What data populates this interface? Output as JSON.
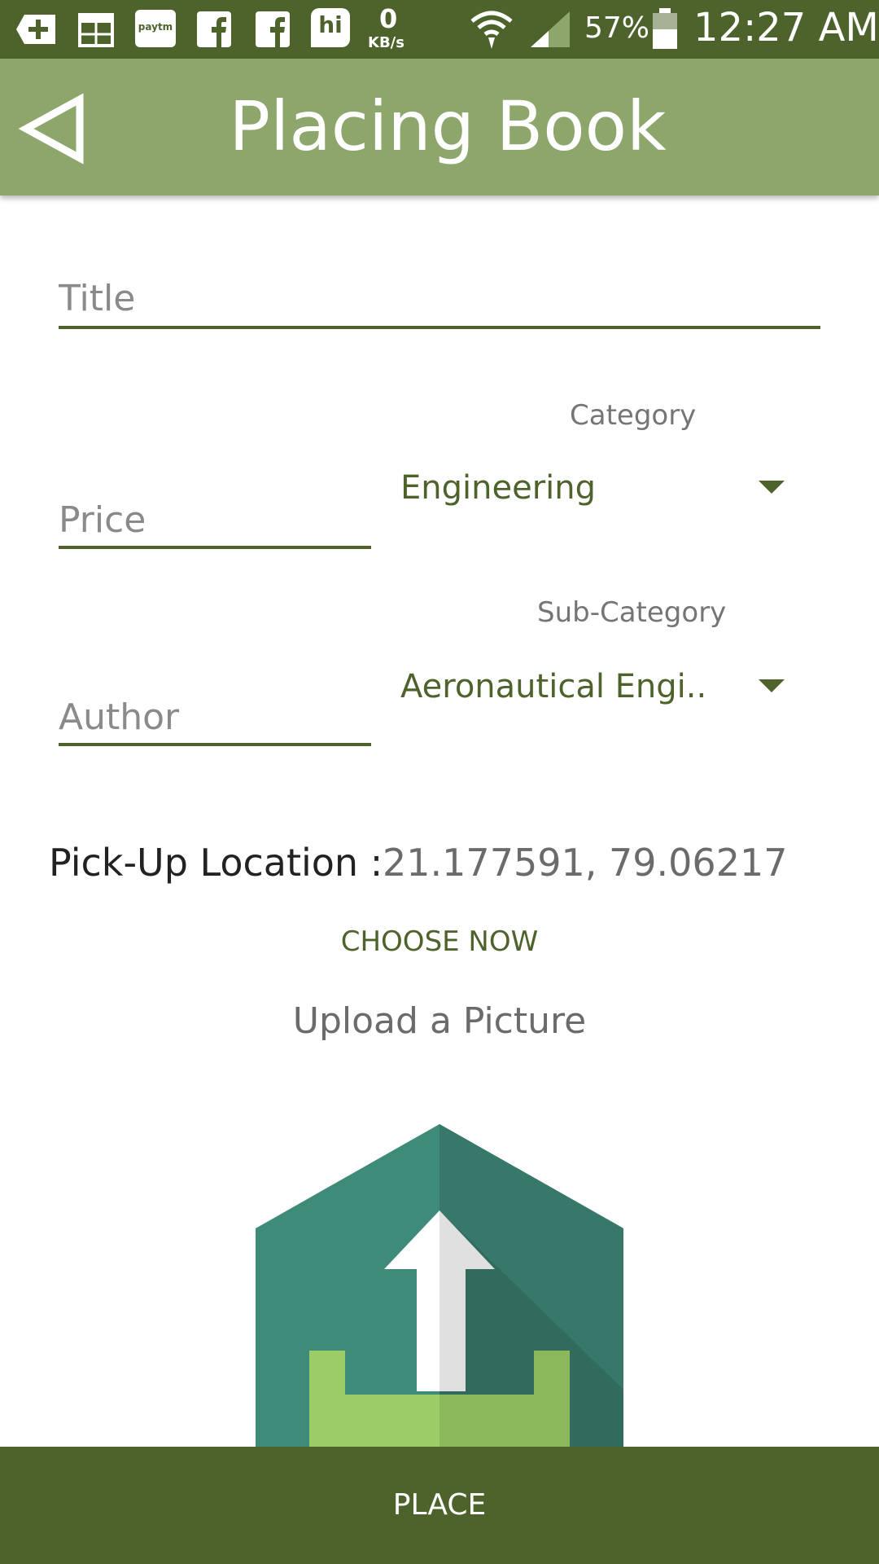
{
  "status_bar": {
    "icons": [
      "add-icon",
      "table-icon",
      "paytm-icon",
      "facebook-icon",
      "facebook-icon",
      "hike-icon",
      "wifi-icon",
      "signal-icon",
      "battery-icon"
    ],
    "paytm_text": "paytm",
    "hike_text": "hi",
    "data_speed_value": "0",
    "data_speed_unit": "KB/s",
    "battery": "57%",
    "time": "12:27 AM"
  },
  "app_bar": {
    "title": "Placing Book"
  },
  "form": {
    "title_placeholder": "Title",
    "price_placeholder": "Price",
    "author_placeholder": "Author",
    "category_label": "Category",
    "category_value": "Engineering",
    "subcategory_label": "Sub-Category",
    "subcategory_value": "Aeronautical Engi.."
  },
  "pickup": {
    "label": "Pick-Up Location :",
    "value": "21.177591, 79.06217",
    "choose_button": "CHOOSE NOW"
  },
  "upload": {
    "label": "Upload a Picture"
  },
  "bottom": {
    "place_button": "PLACE"
  },
  "colors": {
    "status_bar": "#4d632b",
    "app_bar": "#8da66b",
    "accent": "#4d632b",
    "upload_hex": "#3f8b7a",
    "upload_tray": "#9ccc65"
  }
}
